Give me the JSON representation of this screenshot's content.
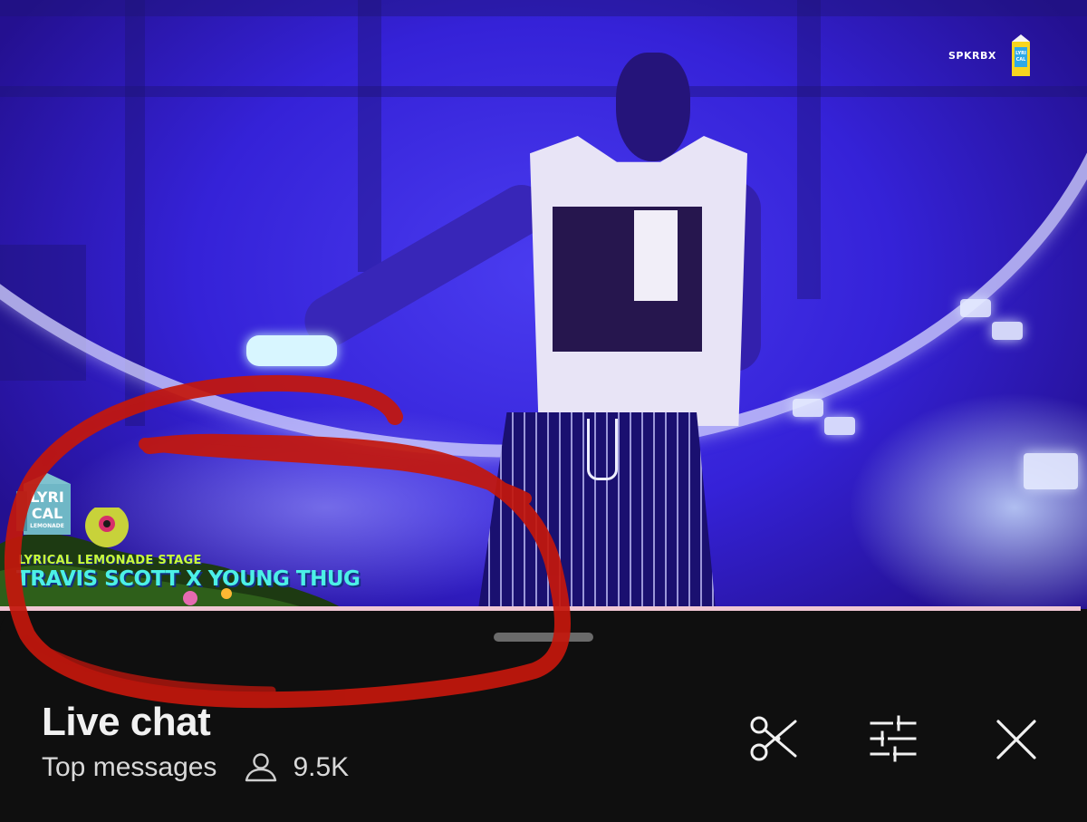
{
  "video": {
    "watermark": "SPKRBX",
    "logo_lines": [
      "LYRI",
      "CAL",
      "LEMONADE"
    ],
    "stage_label": "LYRICAL LEMONADE STAGE",
    "performer_title": "TRAVIS SCOTT X YOUNG THUG"
  },
  "chat": {
    "title": "Live chat",
    "mode_label": "Top messages",
    "viewer_count": "9.5K"
  },
  "icons": {
    "clip": "scissors-icon",
    "filter": "sliders-icon",
    "close": "close-icon",
    "viewers": "person-icon"
  },
  "colors": {
    "panel_bg": "#0f0f0f",
    "annotation": "#c4170c",
    "stage_label": "#c9ff3a",
    "performer_title": "#4cf0e6"
  }
}
